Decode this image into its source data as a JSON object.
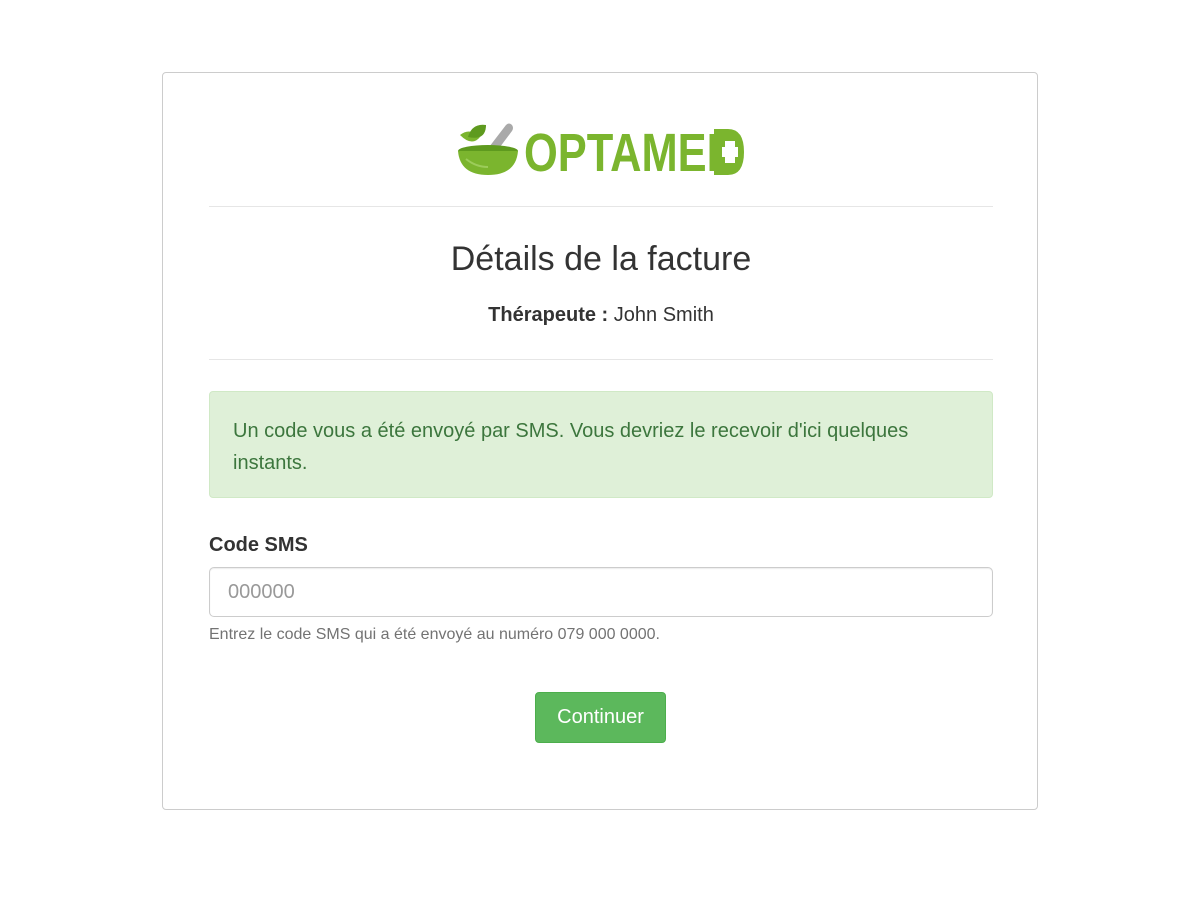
{
  "brand": {
    "name": "OPTAMED",
    "logo_icon": "mortar-pestle-leaf-icon",
    "color": "#7bb52e"
  },
  "page": {
    "title": "Détails de la facture",
    "therapist_label": "Thérapeute :",
    "therapist_name": "John Smith"
  },
  "alert": {
    "message": "Un code vous a été envoyé par SMS. Vous devriez le recevoir d'ici quelques instants.",
    "type": "success",
    "color": "#3c763d",
    "background": "#dff0d8"
  },
  "form": {
    "sms_label": "Code SMS",
    "sms_value": "",
    "sms_placeholder": "000000",
    "help_text": "Entrez le code SMS qui a été envoyé au numéro 079 000 0000.",
    "submit_label": "Continuer",
    "submit_color": "#5cb85c"
  }
}
